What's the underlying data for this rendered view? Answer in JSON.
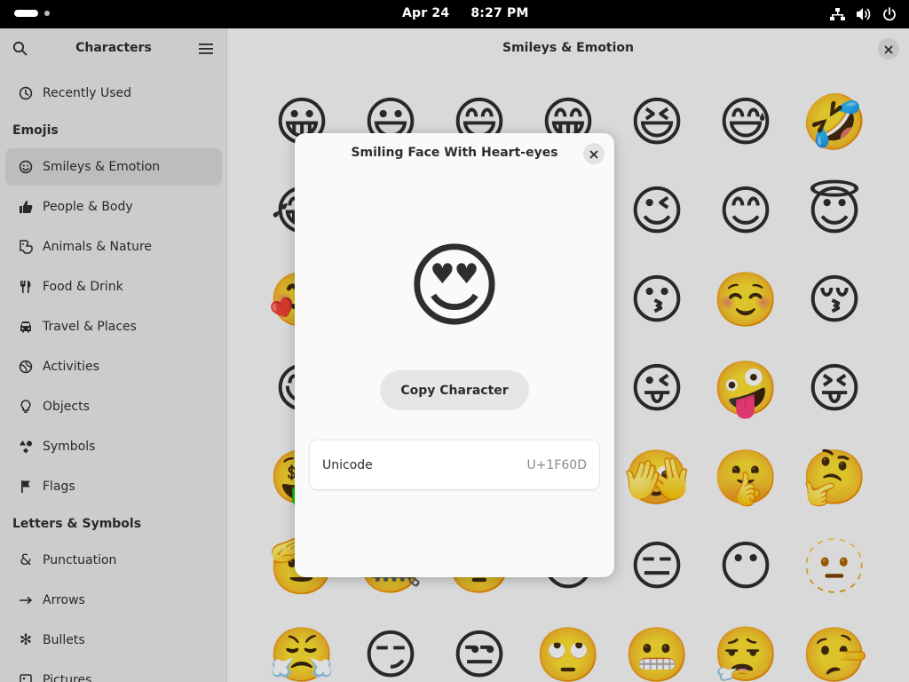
{
  "topbar": {
    "date": "Apr 24",
    "time": "8:27 PM",
    "icons": [
      "network-icon",
      "volume-icon",
      "power-icon"
    ]
  },
  "sidebar": {
    "title": "Characters",
    "section_emojis": "Emojis",
    "section_letters": "Letters & Symbols",
    "items": [
      {
        "label": "Recently Used",
        "icon": "clock-icon"
      },
      {
        "label": "Smileys & Emotion",
        "icon": "smiley-icon",
        "selected": true
      },
      {
        "label": "People & Body",
        "icon": "thumbs-up-icon"
      },
      {
        "label": "Animals & Nature",
        "icon": "paw-icon"
      },
      {
        "label": "Food & Drink",
        "icon": "fork-knife-icon"
      },
      {
        "label": "Travel & Places",
        "icon": "car-icon"
      },
      {
        "label": "Activities",
        "icon": "ball-icon"
      },
      {
        "label": "Objects",
        "icon": "lightbulb-icon"
      },
      {
        "label": "Symbols",
        "icon": "shapes-icon"
      },
      {
        "label": "Flags",
        "icon": "flag-icon"
      },
      {
        "label": "Punctuation",
        "icon": "ampersand-icon"
      },
      {
        "label": "Arrows",
        "icon": "arrow-icon"
      },
      {
        "label": "Bullets",
        "icon": "bullet-icon"
      },
      {
        "label": "Pictures",
        "icon": "picture-icon"
      }
    ]
  },
  "main": {
    "title": "Smileys & Emotion",
    "emojis": [
      "😀",
      "😃",
      "😄",
      "😁",
      "😆",
      "😅",
      "🤣",
      "😂",
      "🙂",
      "🙃",
      "🫠",
      "😉",
      "😊",
      "😇",
      "🥰",
      "😍",
      "🤩",
      "😘",
      "😗",
      "☺️",
      "😚",
      "😋",
      "😛",
      "😜",
      "🤪",
      "😜",
      "🤪",
      "😝",
      "🤑",
      "🤗",
      "🤭",
      "🫢",
      "🫣",
      "🤫",
      "🤔",
      "🫡",
      "🤐",
      "🤨",
      "😐",
      "😑",
      "😶",
      "🫥",
      "😤",
      "😏",
      "😒",
      "🙄",
      "😬",
      "😮‍💨",
      "🤥"
    ]
  },
  "dialog": {
    "title": "Smiling Face With Heart-eyes",
    "emoji": "😍",
    "copy_label": "Copy Character",
    "unicode_label": "Unicode",
    "unicode_value": "U+1F60D"
  }
}
